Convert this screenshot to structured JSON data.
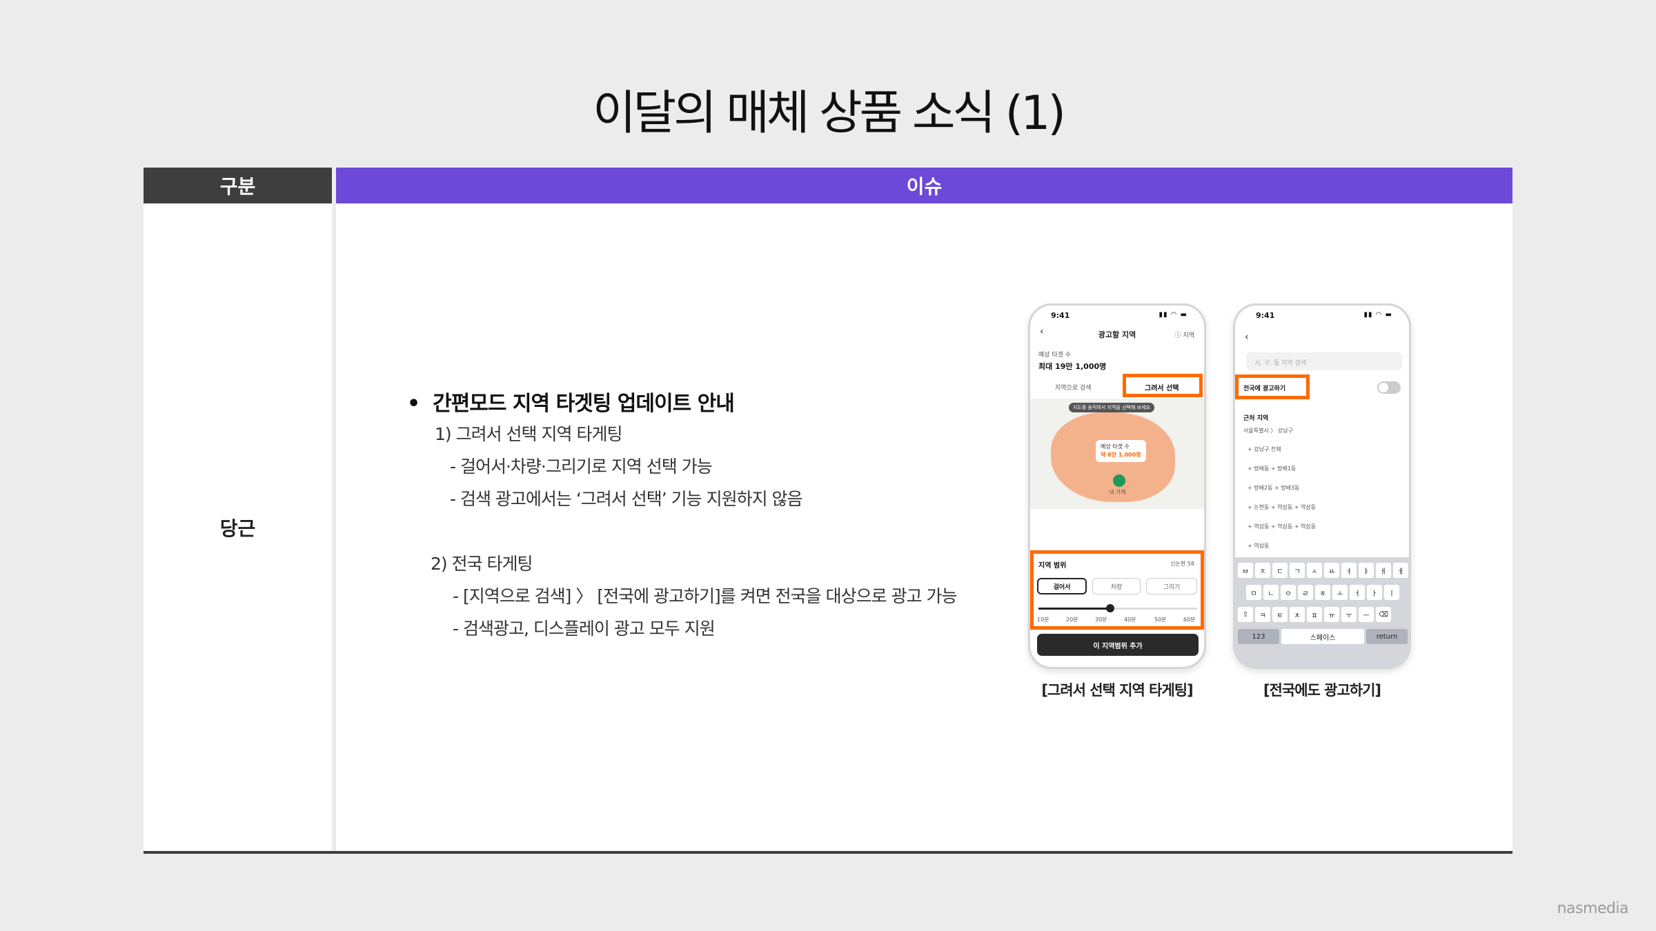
{
  "slide": {
    "title": "이달의 매체 상품 소식 (1)"
  },
  "table": {
    "header_category": "구분",
    "header_issue": "이슈",
    "category": "당근"
  },
  "content": {
    "bullet": "간편모드 지역 타겟팅 업데이트 안내",
    "item1": "1) 그려서 선택 지역 타게팅",
    "item1_sub1": "- 걸어서·차량·그리기로 지역 선택 가능",
    "item1_sub2": "- 검색 광고에서는 ‘그려서 선택’ 기능 지원하지 않음",
    "item2": "2) 전국 타게팅",
    "item2_sub1": "- [지역으로 검색] 〉 [전국에 광고하기]를 켜면 전국을 대상으로 광고 가능",
    "item2_sub2": "- 검색광고, 디스플레이 광고 모두 지원"
  },
  "phone1": {
    "time": "9:41",
    "status_icons": "▮▮ ◠ ▬",
    "title": "광고할 지역",
    "help": "ⓘ 지역",
    "est_label": "예상 타겟 수",
    "est_value": "최대 19만 1,000명",
    "tab_search": "지역으로 검색",
    "tab_draw": "그려서 선택",
    "map_hint": "지도를 움직여서 지역을 선택해 보세요",
    "bubble_line1": "예상 타겟 수",
    "bubble_line2": "약 8만 1,000명",
    "pin_label": "내 가게",
    "range_label": "지역 범위",
    "range_extra": "신논현 58",
    "chip_walk": "걸어서",
    "chip_car": "차량",
    "chip_draw": "그리기",
    "ticks": [
      "10분",
      "20분",
      "30분",
      "40분",
      "50분",
      "60분"
    ],
    "cta": "이 지역범위 추가"
  },
  "phone2": {
    "time": "9:41",
    "status_icons": "▮▮ ◠ ▬",
    "search_placeholder": "시, 구, 동 지역 검색",
    "nationwide_label": "전국에 광고하기",
    "nearby": "근처 지역",
    "crumb": "서울특별시  〉 강남구",
    "area1": "+ 강남구 전체",
    "row1": "+ 방배동     + 방배1동",
    "row2": "+ 방배2동     + 방배3동",
    "row3": "+ 논현동   + 역삼동   + 역삼동",
    "row4": "+ 역삼동   + 역삼동   + 역삼동",
    "row5": "+ 역삼동",
    "kb_row1": [
      "ㅂ",
      "ㅈ",
      "ㄷ",
      "ㄱ",
      "ㅅ",
      "ㅛ",
      "ㅕ",
      "ㅑ",
      "ㅐ",
      "ㅔ"
    ],
    "kb_row2": [
      "ㅁ",
      "ㄴ",
      "ㅇ",
      "ㄹ",
      "ㅎ",
      "ㅗ",
      "ㅓ",
      "ㅏ",
      "ㅣ"
    ],
    "kb_row3": [
      "⇧",
      "ㅋ",
      "ㅌ",
      "ㅊ",
      "ㅍ",
      "ㅠ",
      "ㅜ",
      "ㅡ",
      "⌫"
    ],
    "kb_num": "123",
    "kb_space": "스페이스",
    "kb_return": "return"
  },
  "captions": {
    "phone1": "[그려서 선택 지역 타게팅]",
    "phone2": "[전국에도 광고하기]"
  },
  "footer": {
    "brand": "nasmedia"
  },
  "colors": {
    "header_dark": "#3e3e3e",
    "header_accent": "#6c49d8",
    "highlight": "#ff6a00"
  }
}
